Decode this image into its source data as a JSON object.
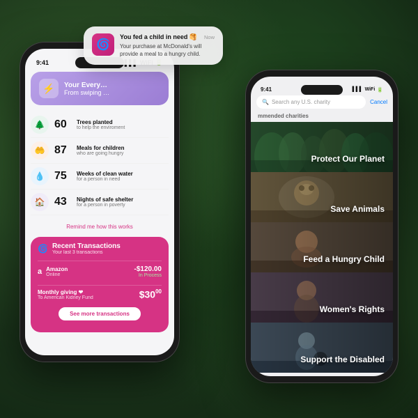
{
  "background": {
    "description": "Aerial forest view"
  },
  "notification": {
    "title": "You fed a child in need 🥞",
    "body": "Your purchase at McDonald's will provide a meal to a hungry child.",
    "time": "Now",
    "app_icon": "🌀"
  },
  "phone_left": {
    "status_bar": {
      "time": "9:41",
      "icons": "●●●"
    },
    "header": {
      "title": "Your Every…",
      "subtitle": "From swiping …",
      "icon": "⚡"
    },
    "stats": [
      {
        "icon": "🌲",
        "color": "#4caf7d",
        "number": "60",
        "desc": "Trees planted",
        "subdesc": "to help the enviroment"
      },
      {
        "icon": "🤲",
        "color": "#e8763a",
        "number": "87",
        "desc": "Meals for children",
        "subdesc": "who are going hungry"
      },
      {
        "icon": "💧",
        "color": "#5bb8e8",
        "number": "75",
        "desc": "Weeks of clean water",
        "subdesc": "for a person in need"
      },
      {
        "icon": "🏠",
        "color": "#9b7dd4",
        "number": "43",
        "desc": "Nights of safe shelter",
        "subdesc": "for a person in poverty"
      }
    ],
    "remind_link": "Remind me how this works",
    "transactions": {
      "title": "Recent Transactions",
      "subtitle": "Your last 3 transactions",
      "items": [
        {
          "logo": "a",
          "name": "Amazon",
          "type": "Online",
          "amount": "-$120.00",
          "status": "In Process"
        }
      ],
      "monthly": {
        "label": "Monthly giving ❤",
        "sublabel": "To American Kidney Fund",
        "amount": "$30",
        "cents": "00"
      },
      "see_more": "See more transactions"
    }
  },
  "phone_right": {
    "status_bar": {
      "time": "9:41",
      "icons": "●●●"
    },
    "search": {
      "placeholder": "Search any U.S. charity",
      "cancel": "Cancel"
    },
    "section_label": "mmended charities",
    "charities": [
      {
        "name": "Protect Our Planet",
        "bg_color1": "#4a7a5a",
        "bg_color2": "#2d5a3a",
        "description": "nature/forest scene"
      },
      {
        "name": "Save Animals",
        "bg_color1": "#7a6a4a",
        "bg_color2": "#5a4a2a",
        "description": "animals scene"
      },
      {
        "name": "Feed a Hungry Child",
        "bg_color1": "#6a5a4a",
        "bg_color2": "#4a3a2a",
        "description": "child/food scene"
      },
      {
        "name": "Women's Rights",
        "bg_color1": "#5a4a5a",
        "bg_color2": "#3a2a3a",
        "description": "women scene"
      },
      {
        "name": "Support the Disabled",
        "bg_color1": "#4a5a6a",
        "bg_color2": "#2a3a4a",
        "description": "disability scene"
      }
    ]
  }
}
